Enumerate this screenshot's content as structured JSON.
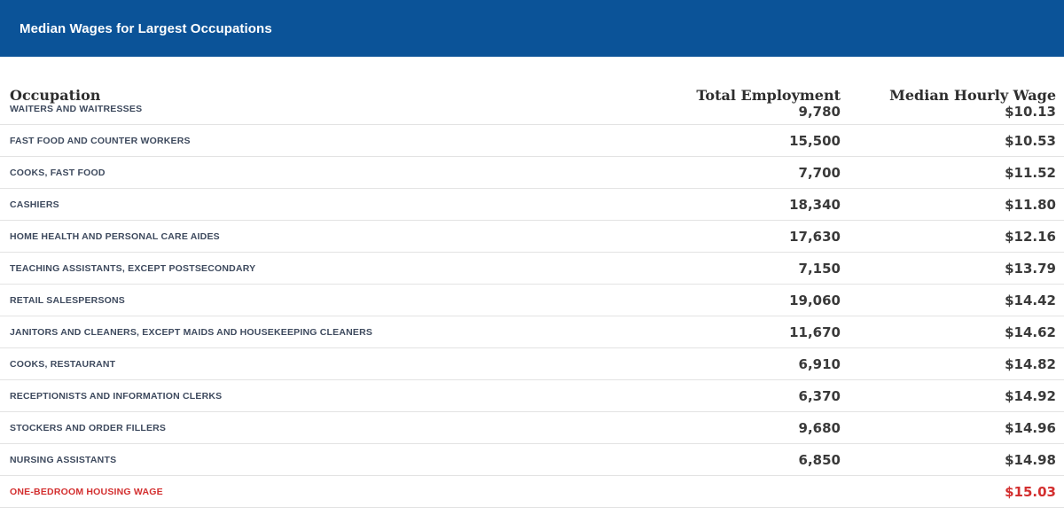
{
  "header": {
    "title": "Median Wages for Largest Occupations"
  },
  "columns": {
    "occupation": "Occupation",
    "employment": "Total Employment",
    "wage": "Median Hourly Wage"
  },
  "rows": [
    {
      "occupation": "WAITERS AND WAITRESSES",
      "employment": "9,780",
      "wage": "$10.13"
    },
    {
      "occupation": "FAST FOOD AND COUNTER WORKERS",
      "employment": "15,500",
      "wage": "$10.53"
    },
    {
      "occupation": "COOKS, FAST FOOD",
      "employment": "7,700",
      "wage": "$11.52"
    },
    {
      "occupation": "CASHIERS",
      "employment": "18,340",
      "wage": "$11.80"
    },
    {
      "occupation": "HOME HEALTH AND PERSONAL CARE AIDES",
      "employment": "17,630",
      "wage": "$12.16"
    },
    {
      "occupation": "TEACHING ASSISTANTS, EXCEPT POSTSECONDARY",
      "employment": "7,150",
      "wage": "$13.79"
    },
    {
      "occupation": "RETAIL SALESPERSONS",
      "employment": "19,060",
      "wage": "$14.42"
    },
    {
      "occupation": "JANITORS AND CLEANERS, EXCEPT MAIDS AND HOUSEKEEPING CLEANERS",
      "employment": "11,670",
      "wage": "$14.62"
    },
    {
      "occupation": "COOKS, RESTAURANT",
      "employment": "6,910",
      "wage": "$14.82"
    },
    {
      "occupation": "RECEPTIONISTS AND INFORMATION CLERKS",
      "employment": "6,370",
      "wage": "$14.92"
    },
    {
      "occupation": "STOCKERS AND ORDER FILLERS",
      "employment": "9,680",
      "wage": "$14.96"
    },
    {
      "occupation": "NURSING ASSISTANTS",
      "employment": "6,850",
      "wage": "$14.98"
    },
    {
      "occupation": "ONE-BEDROOM HOUSING WAGE",
      "employment": "",
      "wage": "$15.03"
    }
  ],
  "colors": {
    "header_bg": "#0b5398",
    "header_text": "#ffffff",
    "occupation_text": "#3e4a5e",
    "value_text": "#3a3a3a",
    "highlight": "#d32f2f",
    "row_divider": "#e3e3e3"
  }
}
